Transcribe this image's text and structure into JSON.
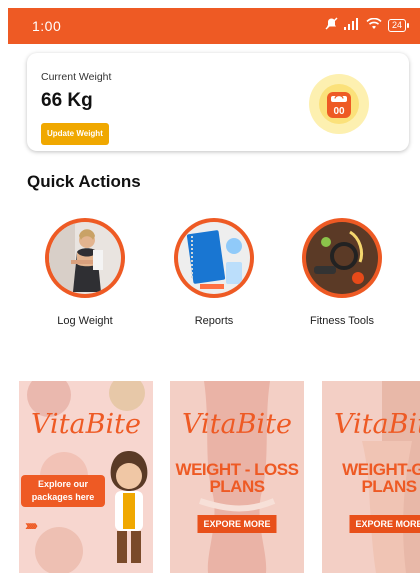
{
  "status_bar": {
    "time": "1:00",
    "signal_text": "..ıl",
    "battery": "24"
  },
  "weight_card": {
    "label": "Current Weight",
    "value": "66 Kg",
    "update_button": "Update Weight",
    "scale_display": "00"
  },
  "quick_actions": {
    "title": "Quick Actions",
    "items": [
      {
        "label": "Log Weight"
      },
      {
        "label": "Reports"
      },
      {
        "label": "Fitness Tools"
      }
    ]
  },
  "banners": [
    {
      "brand": "VitaBite",
      "cta": "Explore our packages here",
      "arrows": "›››››"
    },
    {
      "brand": "VitaBite",
      "headline_1": "WEIGHT - LOSS",
      "headline_2": "PLANS",
      "button": "EXPORE MORE"
    },
    {
      "brand": "VitaBite",
      "headline_1": "WEIGHT-GA",
      "headline_2": "PLANS",
      "button": "EXPORE MORE"
    }
  ],
  "colors": {
    "accent": "#ee5a24",
    "button": "#f0a800",
    "banner_bg": "#f7d6cf"
  }
}
